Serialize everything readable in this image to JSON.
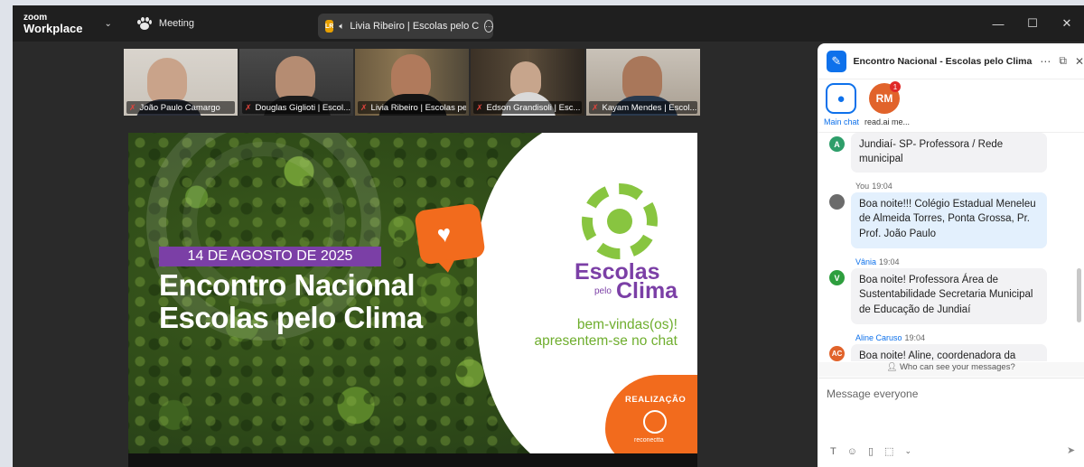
{
  "app": {
    "logo_line1": "zoom",
    "logo_line2": "Workplace",
    "meeting_label": "Meeting",
    "active_speaker_initials": "LR",
    "active_speaker": "Livia Ribeiro | Escolas pelo C",
    "window_controls": [
      "—",
      "☐",
      "✕"
    ]
  },
  "participants": [
    {
      "name": "João Paulo Camargo",
      "muted": true,
      "active": false
    },
    {
      "name": "Douglas Giglioti | Escol...",
      "muted": true,
      "active": false
    },
    {
      "name": "Livia Ribeiro | Escolas pelo...",
      "muted": true,
      "active": true
    },
    {
      "name": "Edson Grandisoli | Esc...",
      "muted": true,
      "active": false
    },
    {
      "name": "Kayam Mendes | Escol...",
      "muted": true,
      "active": false
    }
  ],
  "slide": {
    "date": "14 DE AGOSTO DE 2025",
    "title_line1": "Encontro Nacional",
    "title_line2": "Escolas pelo Clima",
    "brand_line1": "Escolas",
    "brand_pelo": "pelo",
    "brand_clima": "Clima",
    "welcome_line1": "bem-vindas(os)!",
    "welcome_line2": "apresentem-se no chat",
    "realizacao": "REALIZAÇÃO",
    "realizacao_org": "reconectta"
  },
  "chat": {
    "title": "Encontro Nacional - Escolas pelo Clima",
    "tabs": [
      {
        "label": "Main chat",
        "icon": "paw-icon"
      },
      {
        "label": "read.ai me...",
        "initials": "RM",
        "badge": "1"
      }
    ],
    "messages": [
      {
        "avatar": "A",
        "avatar_color": "#2e9e6a",
        "sender": "",
        "time": "",
        "text": "Jundiaí- SP- Professora / Rede municipal",
        "mine": false
      },
      {
        "avatar": "",
        "avatar_color": "#6b6b6b",
        "sender": "You",
        "time": "19:04",
        "text": "Boa noite!!! Colégio Estadual Meneleu de Almeida Torres, Ponta Grossa, Pr. Prof. João Paulo",
        "mine": true
      },
      {
        "avatar": "V",
        "avatar_color": "#2e9e3e",
        "sender": "Vânia",
        "time": "19:04",
        "text": "Boa noite! Professora Área de Sustentabilidade Secretaria Municipal de Educação de Jundiaí",
        "mine": false
      },
      {
        "avatar": "AC",
        "avatar_color": "#e1632b",
        "sender": "Aline Caruso",
        "time": "19:04",
        "text": "Boa noite! Aline, coordenadora da",
        "mine": false
      }
    ],
    "who_can_see": "Who can see your messages?",
    "compose_placeholder": "Message everyone"
  },
  "colors": {
    "accent": "#0e71eb",
    "slide_purple": "#7b3fa6",
    "slide_orange": "#f26b1d",
    "slide_green": "#6fae2e",
    "active_tile": "#35c26b"
  }
}
